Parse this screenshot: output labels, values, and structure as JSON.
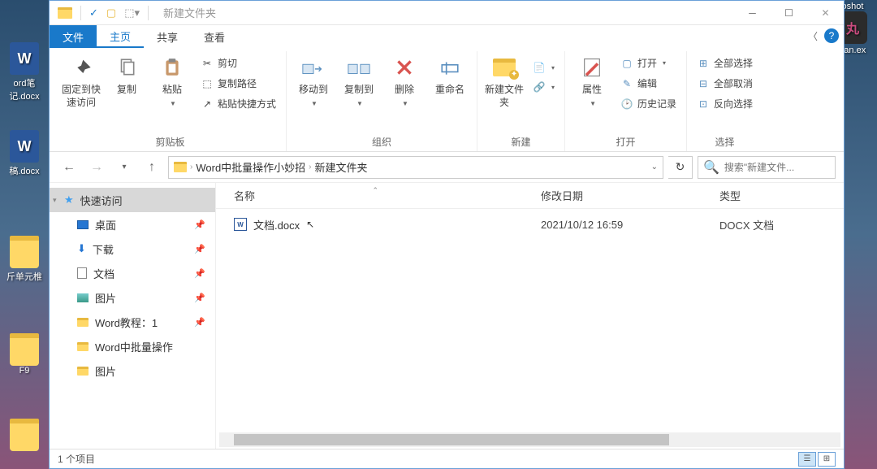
{
  "desktop": {
    "icons": [
      {
        "label": "ord笔记.docx"
      },
      {
        "label": "稿.docx"
      },
      {
        "label": "斤单元椎"
      },
      {
        "label": "F9"
      }
    ],
    "right_icons": [
      {
        "label": "oshot"
      },
      {
        "label": "van.ex"
      }
    ]
  },
  "window": {
    "title": "新建文件夹",
    "qat_check": "✓"
  },
  "tabs": {
    "file": "文件",
    "home": "主页",
    "share": "共享",
    "view": "查看"
  },
  "ribbon": {
    "pin": "固定到快速访问",
    "copy": "复制",
    "paste": "粘贴",
    "cut": "剪切",
    "copy_path": "复制路径",
    "paste_shortcut": "粘贴快捷方式",
    "clipboard_group": "剪贴板",
    "move_to": "移动到",
    "copy_to": "复制到",
    "delete": "删除",
    "rename": "重命名",
    "organize_group": "组织",
    "new_folder": "新建文件夹",
    "new_group": "新建",
    "properties": "属性",
    "open": "打开",
    "edit": "编辑",
    "history": "历史记录",
    "open_group": "打开",
    "select_all": "全部选择",
    "select_none": "全部取消",
    "invert": "反向选择",
    "select_group": "选择"
  },
  "breadcrumb": {
    "seg1": "Word中批量操作小妙招",
    "seg2": "新建文件夹"
  },
  "search": {
    "placeholder": "搜索\"新建文件..."
  },
  "nav": {
    "quick_access": "快速访问",
    "desktop": "桌面",
    "downloads": "下载",
    "documents": "文档",
    "pictures": "图片",
    "word_tutorial": "Word教程：1",
    "word_batch": "Word中批量操作",
    "pictures2": "图片"
  },
  "columns": {
    "name": "名称",
    "date": "修改日期",
    "type": "类型"
  },
  "files": [
    {
      "name": "文档.docx",
      "date": "2021/10/12 16:59",
      "type": "DOCX 文档"
    }
  ],
  "status": {
    "count": "1 个项目"
  }
}
